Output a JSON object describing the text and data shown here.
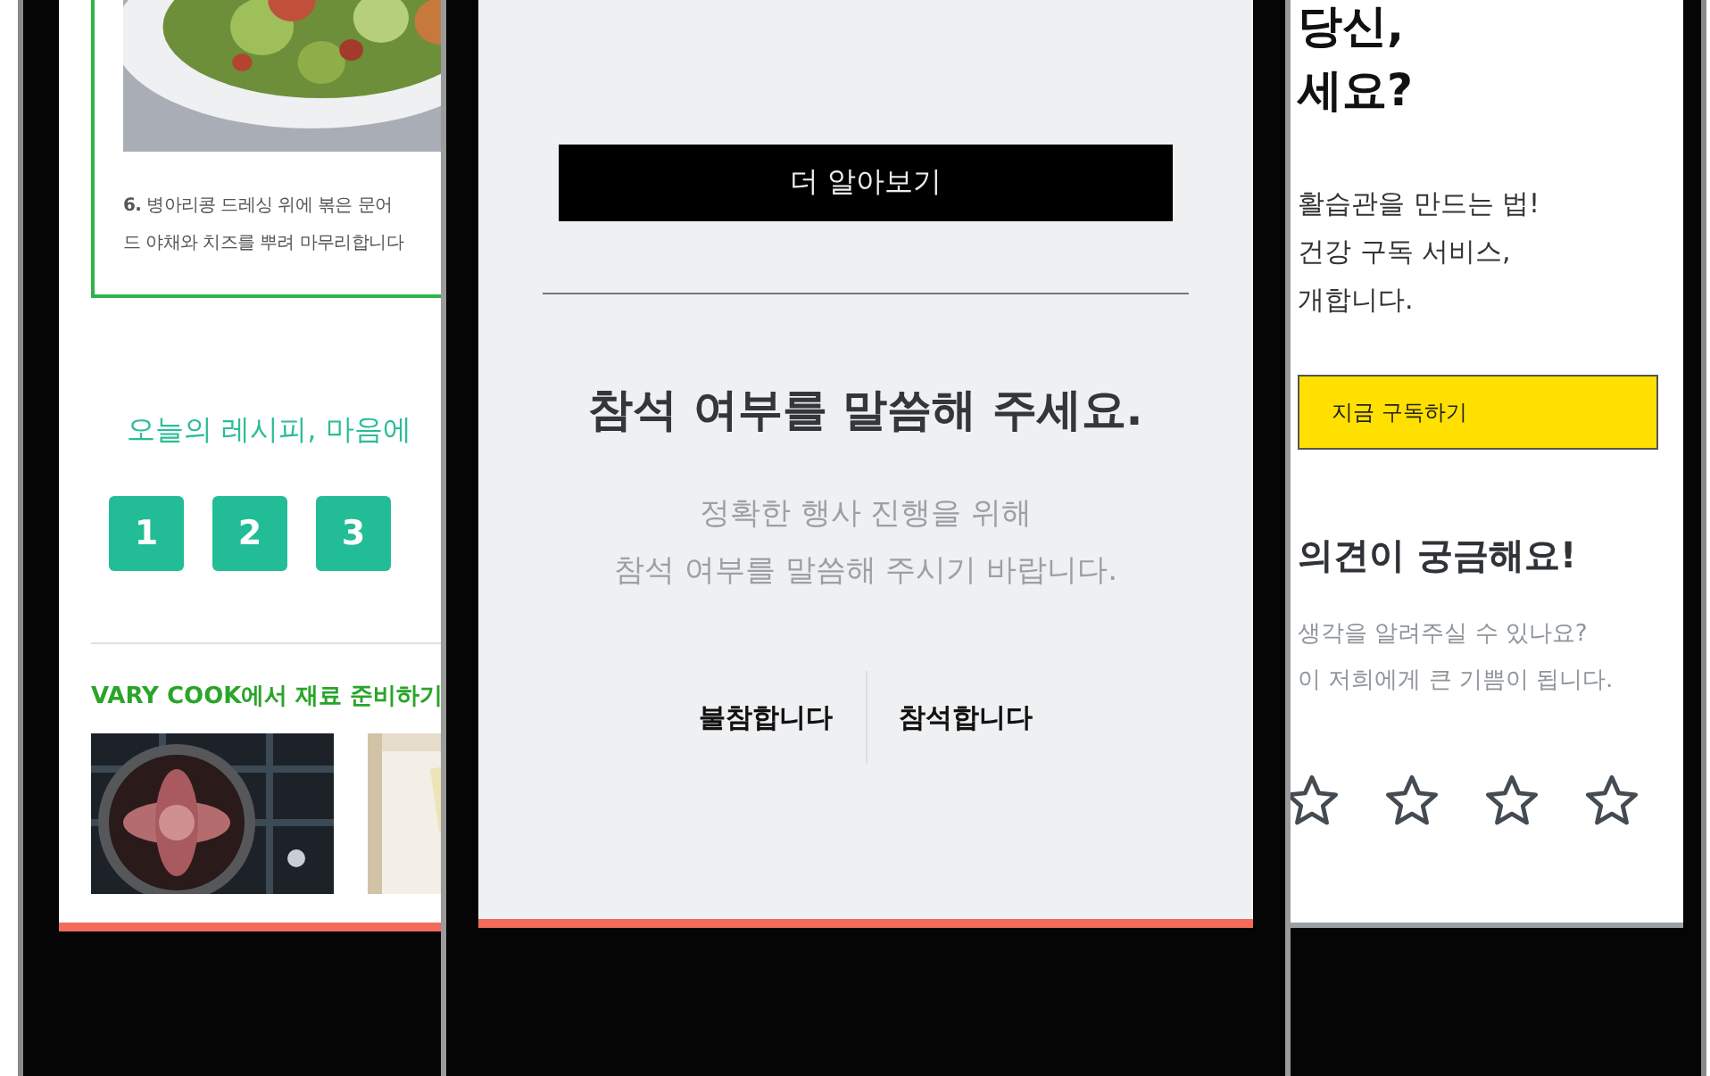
{
  "left_phone": {
    "step_lines": [
      "**6.** 병아리콩 드레싱 위에 볶은 문어",
      "드 야채와 치즈를 뿌려 마무리합니다"
    ],
    "prompt": "오늘의 레시피, 마음에",
    "pages": [
      "1",
      "2",
      "3"
    ],
    "section_title": "VARY COOK에서 재료 준비하기"
  },
  "center_phone": {
    "button": "더 알아보기",
    "title": "참석 여부를 말씀해 주세요.",
    "subtitle": "정확한 행사 진행을 위해\n참석 여부를 말씀해 주시기 바랍니다.",
    "choices": [
      "불참합니다",
      "참석합니다"
    ]
  },
  "right_phone": {
    "heading": "당신,\n세요?",
    "body": "활습관을 만드는 법!\n건강 구독 서비스,\n개합니다.",
    "button": "지금 구독하기",
    "feedback_title": "의견이 궁금해요!",
    "feedback_text": "생각을 알려주실 수 있나요?\n이 저희에게 큰 기쁨이 됩니다.",
    "stars": 0
  }
}
